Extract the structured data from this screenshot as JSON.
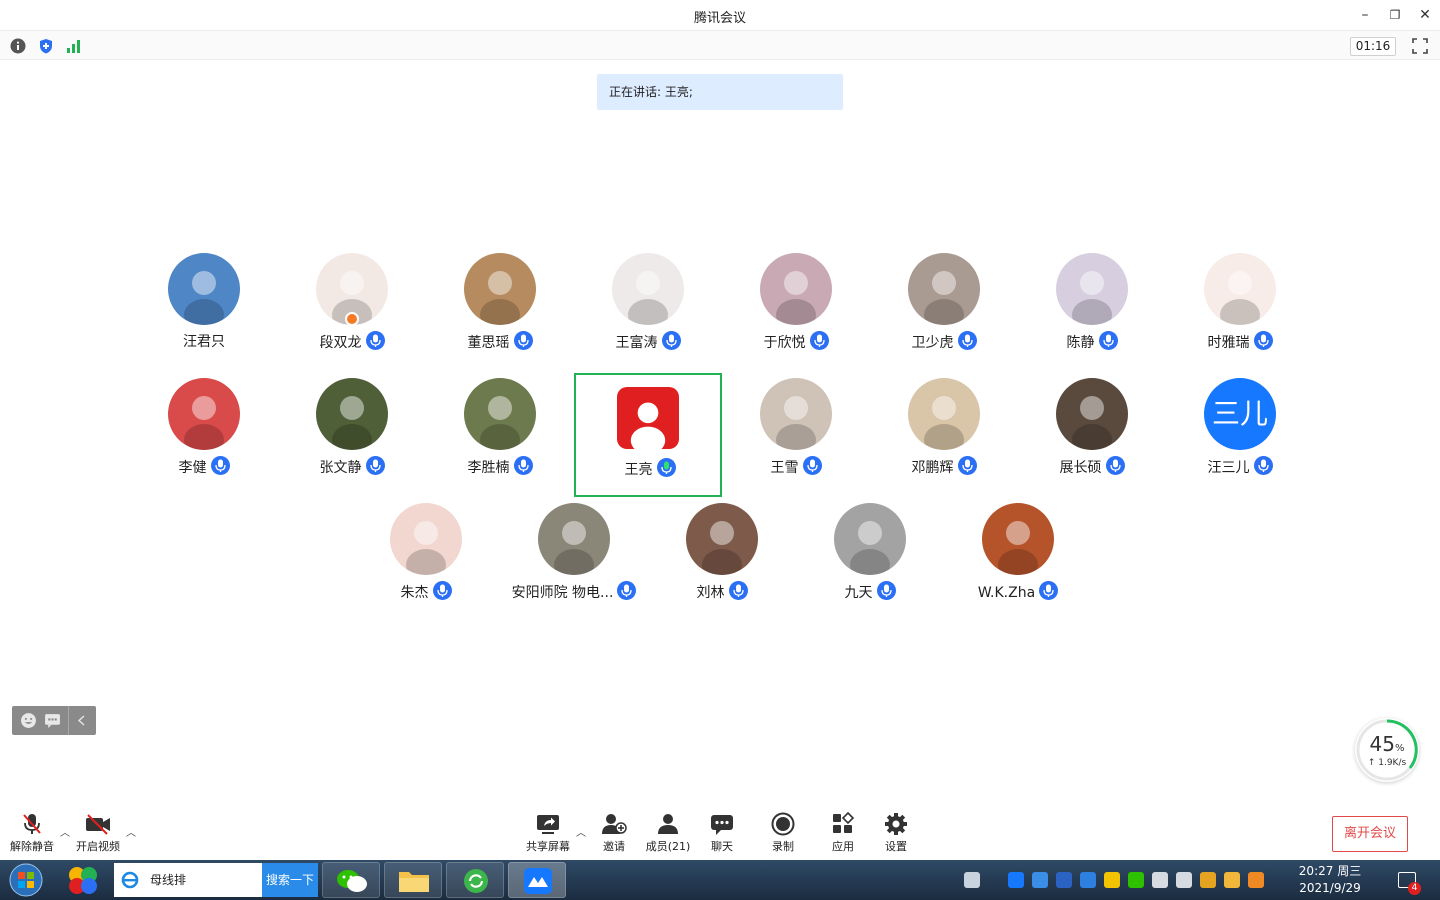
{
  "window": {
    "title": "腾讯会议",
    "minimize": "–",
    "restore": "❐",
    "close": "✕"
  },
  "status": {
    "timer": "01:16"
  },
  "speaking_banner": "正在讲话: 王亮;",
  "participants": [
    {
      "name": "汪君只",
      "mic": false,
      "color": "#4f86c6"
    },
    {
      "name": "段双龙",
      "mic": true,
      "color": "#f3e9e4"
    },
    {
      "name": "董思瑶",
      "mic": true,
      "color": "#b58b5f"
    },
    {
      "name": "王富涛",
      "mic": true,
      "color": "#eeeaea"
    },
    {
      "name": "于欣悦",
      "mic": true,
      "color": "#c8a9b4"
    },
    {
      "name": "卫少虎",
      "mic": true,
      "color": "#a99a92"
    },
    {
      "name": "陈静",
      "mic": true,
      "color": "#d7cfe0"
    },
    {
      "name": "时雅瑞",
      "mic": true,
      "color": "#f7ece7"
    },
    {
      "name": "李健",
      "mic": true,
      "color": "#d94a4a"
    },
    {
      "name": "张文静",
      "mic": true,
      "color": "#4f5f38"
    },
    {
      "name": "李胜楠",
      "mic": true,
      "color": "#6d7a4e"
    },
    {
      "name": "王亮",
      "mic": true,
      "color": "#e02020"
    },
    {
      "name": "王雪",
      "mic": true,
      "color": "#cfc3b8"
    },
    {
      "name": "邓鹏辉",
      "mic": true,
      "color": "#d9c5a8"
    },
    {
      "name": "展长硕",
      "mic": true,
      "color": "#5a4a3e"
    },
    {
      "name": "汪三儿",
      "mic": true,
      "color": "#1677ff",
      "initials": "三儿"
    },
    {
      "name": "朱杰",
      "mic": true,
      "color": "#f1d7cf"
    },
    {
      "name": "安阳师院 物电...",
      "mic": true,
      "color": "#8a8678"
    },
    {
      "name": "刘林",
      "mic": true,
      "color": "#7d5a4a"
    },
    {
      "name": "九天",
      "mic": true,
      "color": "#a3a3a3"
    },
    {
      "name": "W.K.Zha",
      "mic": true,
      "color": "#b5542a"
    }
  ],
  "speed": {
    "percent": "45",
    "unit": "%",
    "rate": "↑ 1.9K/s"
  },
  "toolbar": {
    "unmute": "解除静音",
    "video": "开启视频",
    "share": "共享屏幕",
    "invite": "邀请",
    "members": "成员(21)",
    "chat": "聊天",
    "record": "录制",
    "apps": "应用",
    "settings": "设置",
    "leave": "离开会议"
  },
  "taskbar": {
    "address": "母线排",
    "search": "搜索一下",
    "time": "20:27 周三",
    "date": "2021/9/29",
    "badge": "4"
  }
}
